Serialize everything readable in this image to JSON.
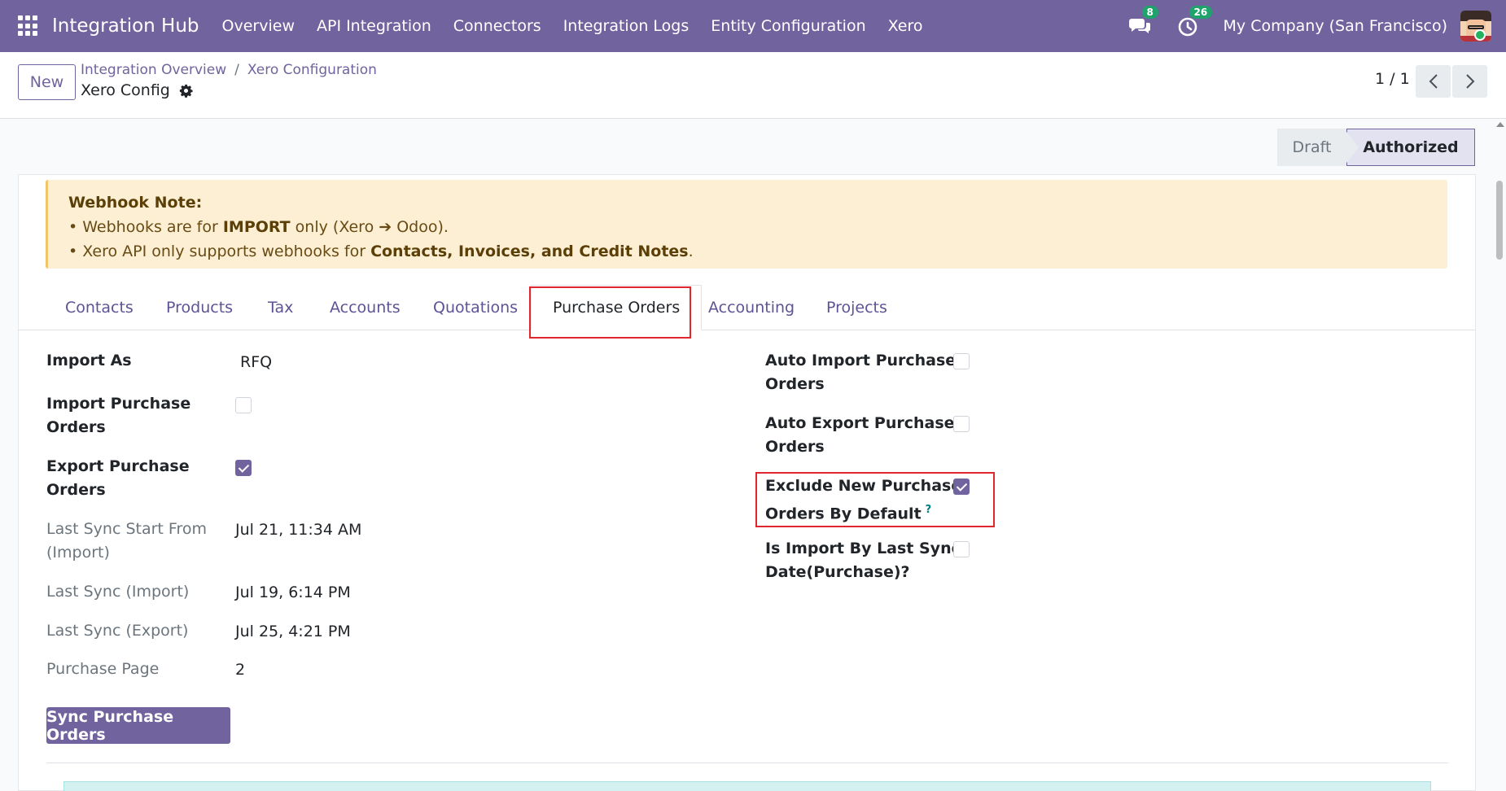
{
  "navbar": {
    "brand": "Integration Hub",
    "items": [
      "Overview",
      "API Integration",
      "Connectors",
      "Integration Logs",
      "Entity Configuration",
      "Xero"
    ],
    "messages_badge": "8",
    "activities_badge": "26",
    "company": "My Company (San Francisco)",
    "accent_color": "#71639e"
  },
  "control_panel": {
    "new_label": "New",
    "breadcrumb": [
      "Integration Overview",
      "Xero Configuration"
    ],
    "breadcrumb_sep": "/",
    "record_title": "Xero Config",
    "pager": "1 / 1"
  },
  "statusbar": {
    "draft": "Draft",
    "authorized": "Authorized",
    "current": "Authorized"
  },
  "webhook": {
    "title": "Webhook Note:",
    "line1_prefix": "• Webhooks are for ",
    "line1_bold": "IMPORT",
    "line1_suffix": " only (Xero ➔ Odoo).",
    "line2_prefix": "• Xero API only supports webhooks for ",
    "line2_bold": "Contacts, Invoices, and Credit Notes",
    "line2_suffix": "."
  },
  "tabs": [
    "Contacts",
    "Products",
    "Tax",
    "Accounts",
    "Quotations",
    "Purchase Orders",
    "Accounting",
    "Projects"
  ],
  "active_tab": "Purchase Orders",
  "left_fields": {
    "import_as_label": "Import As",
    "import_as_value": "RFQ",
    "import_po_label_1": "Import Purchase",
    "import_po_label_2": "Orders",
    "import_po_checked": false,
    "export_po_label_1": "Export Purchase",
    "export_po_label_2": "Orders",
    "export_po_checked": true,
    "last_sync_start_label_1": "Last Sync Start From",
    "last_sync_start_label_2": "(Import)",
    "last_sync_start_value": "Jul 21, 11:34 AM",
    "last_sync_import_label": "Last Sync (Import)",
    "last_sync_import_value": "Jul 19, 6:14 PM",
    "last_sync_export_label": "Last Sync (Export)",
    "last_sync_export_value": "Jul 25, 4:21 PM",
    "purchase_page_label": "Purchase Page",
    "purchase_page_value": "2"
  },
  "right_fields": {
    "auto_import_label_1": "Auto Import Purchase",
    "auto_import_label_2": "Orders",
    "auto_import_checked": false,
    "auto_export_label_1": "Auto Export Purchase",
    "auto_export_label_2": "Orders",
    "auto_export_checked": false,
    "exclude_label_1": "Exclude New Purchase",
    "exclude_label_2": "Orders By Default",
    "exclude_help": "?",
    "exclude_checked": true,
    "import_last_sync_label_1": "Is Import By Last Sync",
    "import_last_sync_label_2": "Date(Purchase)?",
    "import_last_sync_checked": false
  },
  "sync_button": "Sync Purchase Orders"
}
